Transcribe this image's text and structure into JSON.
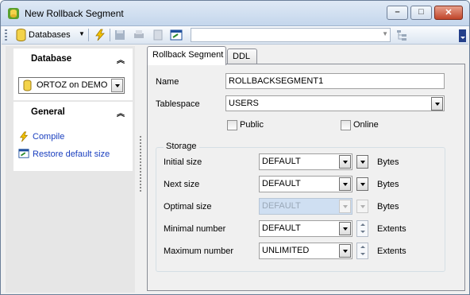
{
  "window": {
    "title": "New Rollback Segment"
  },
  "toolbar": {
    "databases_label": "Databases",
    "combo_value": ""
  },
  "left": {
    "database_header": "Database",
    "database_value": "ORTOZ on DEMO",
    "general_header": "General",
    "actions": [
      {
        "label": "Compile",
        "icon": "lightning-icon"
      },
      {
        "label": "Restore default size",
        "icon": "window-restore-icon"
      }
    ]
  },
  "tabs": [
    {
      "label": "Rollback Segment",
      "active": true
    },
    {
      "label": "DDL",
      "active": false
    }
  ],
  "form": {
    "name_label": "Name",
    "name_value": "ROLLBACKSEGMENT1",
    "tablespace_label": "Tablespace",
    "tablespace_value": "USERS",
    "public_label": "Public",
    "public_checked": false,
    "online_label": "Online",
    "online_checked": false
  },
  "storage": {
    "group_label": "Storage",
    "rows": [
      {
        "label": "Initial size",
        "value": "DEFAULT",
        "unit": "Bytes",
        "enabled": true
      },
      {
        "label": "Next size",
        "value": "DEFAULT",
        "unit": "Bytes",
        "enabled": true
      },
      {
        "label": "Optimal size",
        "value": "DEFAULT",
        "unit": "Bytes",
        "enabled": false
      },
      {
        "label": "Minimal number",
        "value": "DEFAULT",
        "unit": "Extents",
        "enabled": true
      },
      {
        "label": "Maximum number",
        "value": "UNLIMITED",
        "unit": "Extents",
        "enabled": true
      }
    ]
  },
  "colors": {
    "accent": "#24408a",
    "link": "#1a3fbf",
    "close": "#c0452a"
  }
}
